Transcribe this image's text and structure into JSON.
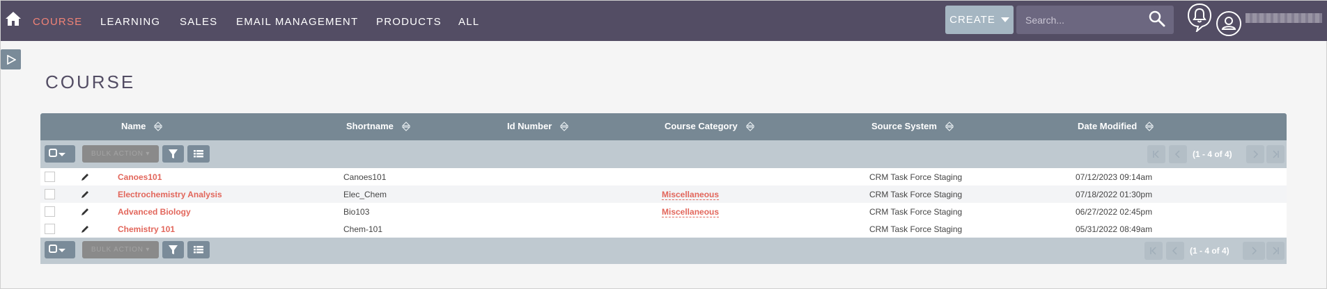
{
  "nav": {
    "items": [
      "COURSE",
      "LEARNING",
      "SALES",
      "EMAIL MANAGEMENT",
      "PRODUCTS",
      "ALL"
    ],
    "active": "COURSE",
    "create_label": "CREATE",
    "search_placeholder": "Search..."
  },
  "page": {
    "title": "COURSE"
  },
  "table": {
    "columns": [
      "Name",
      "Shortname",
      "Id Number",
      "Course Category",
      "Source System",
      "Date Modified"
    ],
    "bulk_action_label": "BULK ACTION",
    "pagination_text": "(1 - 4 of 4)",
    "rows": [
      {
        "name": "Canoes101",
        "shortname": "Canoes101",
        "id_number": "",
        "category": "",
        "source": "CRM Task Force Staging",
        "date": "07/12/2023 09:14am"
      },
      {
        "name": "Electrochemistry Analysis",
        "shortname": "Elec_Chem",
        "id_number": "",
        "category": "Miscellaneous",
        "source": "CRM Task Force Staging",
        "date": "07/18/2022 01:30pm"
      },
      {
        "name": "Advanced Biology",
        "shortname": "Bio103",
        "id_number": "",
        "category": "Miscellaneous",
        "source": "CRM Task Force Staging",
        "date": "06/27/2022 02:45pm"
      },
      {
        "name": "Chemistry 101",
        "shortname": "Chem-101",
        "id_number": "",
        "category": "",
        "source": "CRM Task Force Staging",
        "date": "05/31/2022 08:49am"
      }
    ]
  },
  "colors": {
    "topbar": "#534d64",
    "accent": "#f08377",
    "link": "#e2665b",
    "table_header": "#778894",
    "toolbar": "#bfc9d0"
  },
  "icons": [
    "home-icon",
    "search-icon",
    "bell-icon",
    "user-icon",
    "sidebar-toggle-icon",
    "sort-icon",
    "edit-pencil-icon",
    "filter-icon",
    "column-chooser-icon",
    "first-page-icon",
    "prev-page-icon",
    "next-page-icon",
    "last-page-icon"
  ]
}
